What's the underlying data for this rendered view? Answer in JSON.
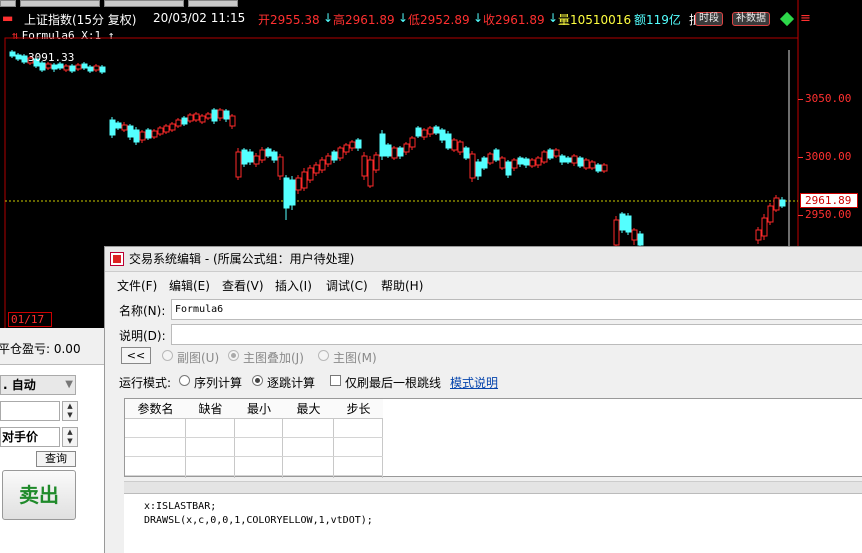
{
  "chart": {
    "index_name": "上证指数(15分 复权)",
    "datetime": "20/03/02 11:15",
    "open": "开2955.38",
    "high": "高2961.89",
    "low": "低2952.89",
    "close": "收2961.89",
    "volume": "量10510016",
    "amount": "额119亿",
    "truncated": "抵",
    "chip_timeframe": "时段",
    "chip_data": "补数据",
    "formula_label": "Formula6 X:1",
    "overlay_price": "3091.33",
    "axis_labels": [
      "3050.00",
      "3000.00",
      "2950.00"
    ],
    "current_price": "2961.89",
    "date_label": "01/17",
    "chart_data": {
      "type": "candlestick",
      "y_axis_ticks": [
        3050,
        3000,
        2950
      ],
      "current_price": 2961.89
    }
  },
  "trade_panel": {
    "status": "平仓盈亏: 0.00",
    "mode_select": ". 自动",
    "price_type": "对手价",
    "query_button": "查询",
    "sell_button": "卖出"
  },
  "editor": {
    "title": "交易系统编辑 - (所属公式组：用户待处理)",
    "menu": [
      "文件(F)",
      "编辑(E)",
      "查看(V)",
      "插入(I)",
      "调试(C)",
      "帮助(H)"
    ],
    "name_label": "名称(N):",
    "name_value": "Formula6",
    "desc_label": "说明(D):",
    "desc_value": "",
    "back_button": "<<",
    "chart_options": [
      "副图(U)",
      "主图叠加(J)",
      "主图(M)"
    ],
    "run_mode_label": "运行模式:",
    "run_modes": [
      "序列计算",
      "逐跳计算"
    ],
    "last_bar_only": "仅刷最后一根跳线",
    "mode_help": "模式说明",
    "param_headers": [
      "参数名",
      "缺省",
      "最小",
      "最大",
      "步长"
    ],
    "code_lines": [
      "x:ISLASTBAR;",
      "DRAWSL(x,c,0,0,1,COLORYELLOW,1,vtDOT);"
    ]
  },
  "colors": {
    "up": "#ff2a2a",
    "down": "#54ffff",
    "axis": "#ff3030",
    "dotted_line": "#cccc00",
    "sell_text": "#1f8a2a",
    "link": "#0645ad"
  }
}
